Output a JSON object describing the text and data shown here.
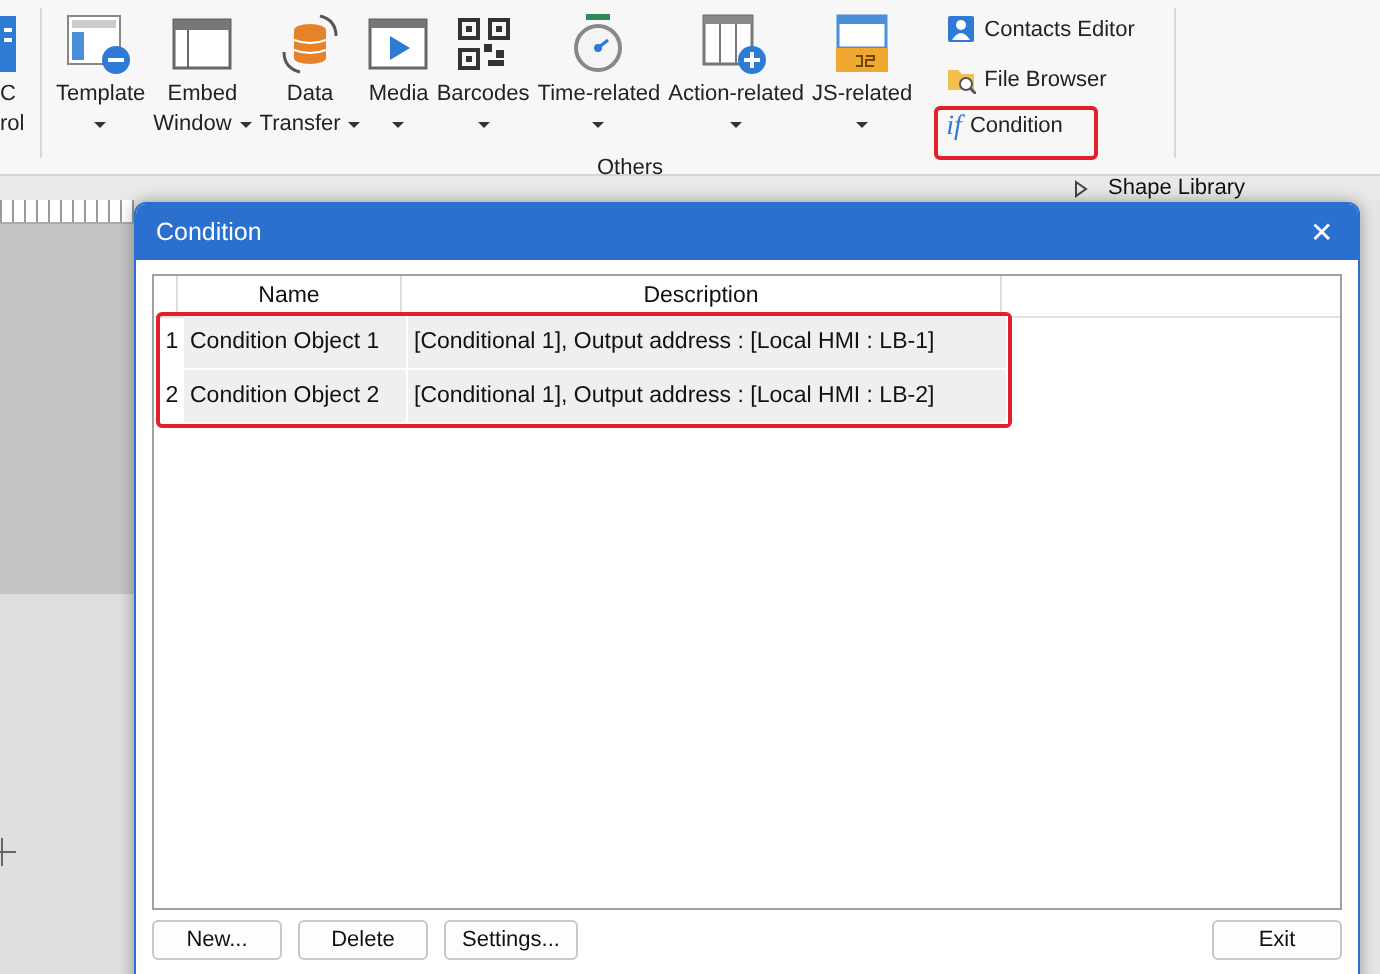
{
  "ribbon": {
    "cut_item": {
      "lines": [
        "C",
        "rol"
      ]
    },
    "items": [
      {
        "lines": [
          "Template"
        ],
        "dropdown": true
      },
      {
        "lines": [
          "Embed",
          "Window"
        ],
        "dropdown": true
      },
      {
        "lines": [
          "Data",
          "Transfer"
        ],
        "dropdown": true
      },
      {
        "lines": [
          "Media"
        ],
        "dropdown": true
      },
      {
        "lines": [
          "Barcodes"
        ],
        "dropdown": true
      },
      {
        "lines": [
          "Time-related"
        ],
        "dropdown": true
      },
      {
        "lines": [
          "Action-related"
        ],
        "dropdown": true
      },
      {
        "lines": [
          "JS-related"
        ],
        "dropdown": true
      }
    ],
    "small_items": [
      {
        "label": "Contacts Editor",
        "highlighted": false
      },
      {
        "label": "File Browser",
        "highlighted": false
      },
      {
        "label": "Condition",
        "icon_text": "if",
        "highlighted": true
      }
    ],
    "group_label": "Others"
  },
  "panel_header": {
    "title": "Shape Library"
  },
  "dialog": {
    "title": "Condition",
    "close": "✕",
    "columns": [
      "Name",
      "Description"
    ],
    "rows": [
      {
        "number": "1",
        "name": "Condition Object 1",
        "description": "[Conditional 1], Output address : [Local HMI : LB-1]",
        "highlighted": true
      },
      {
        "number": "2",
        "name": "Condition Object 2",
        "description": "[Conditional 1], Output address : [Local HMI : LB-2]",
        "highlighted": true
      }
    ],
    "buttons": [
      "New...",
      "Delete",
      "Settings..."
    ],
    "exit_button": "Exit"
  }
}
